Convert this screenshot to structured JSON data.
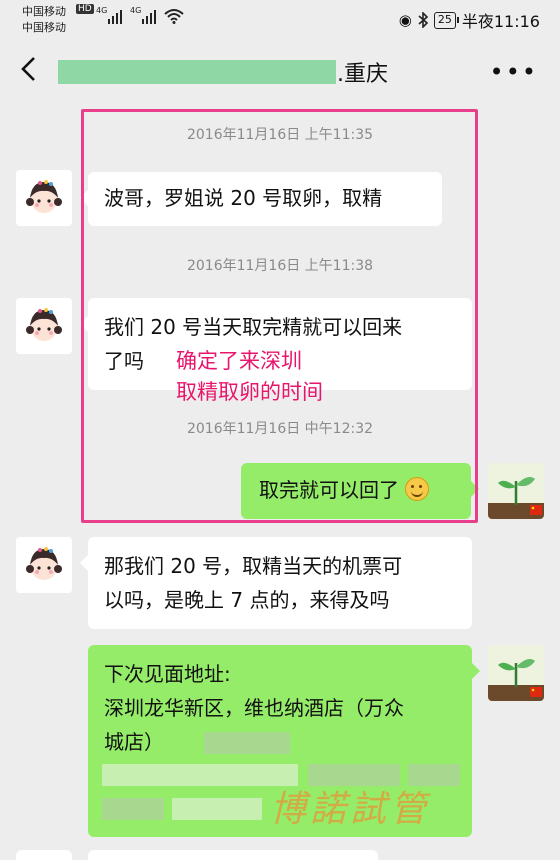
{
  "status_bar": {
    "carrier1": "中国移动",
    "carrier2": "中国移动",
    "hd": "HD",
    "net1": "4G",
    "net2": "4G",
    "battery": "25",
    "time": "半夜11:16"
  },
  "header": {
    "title": ".重庆",
    "more": "•••"
  },
  "messages": [
    {
      "timestamp": "2016年11月16日 上午11:35",
      "side": "left",
      "text": "波哥，罗姐说 20 号取卵，取精"
    },
    {
      "timestamp": "2016年11月16日 上午11:38",
      "side": "left",
      "line1": "我们 20 号当天取完精就可以回来",
      "line2": "了吗"
    },
    {
      "timestamp": "2016年11月16日 中午12:32",
      "side": "right",
      "text": "取完就可以回了"
    },
    {
      "side": "left",
      "line1": "那我们 20 号，取精当天的机票可",
      "line2": "以吗，是晚上 7 点的，来得及吗"
    },
    {
      "side": "right",
      "line1": "下次见面地址:",
      "line2": "深圳龙华新区，维也纳酒店（万众",
      "line3": "城店）"
    }
  ],
  "annotation": {
    "line1": "确定了来深圳",
    "line2": "取精取卵的时间"
  },
  "watermark": "博諾試管",
  "colors": {
    "background": "#ededed",
    "bubble_out": "#95ec69",
    "bubble_in": "#ffffff",
    "highlight": "#e83e8c",
    "annotation": "#e8156c"
  }
}
